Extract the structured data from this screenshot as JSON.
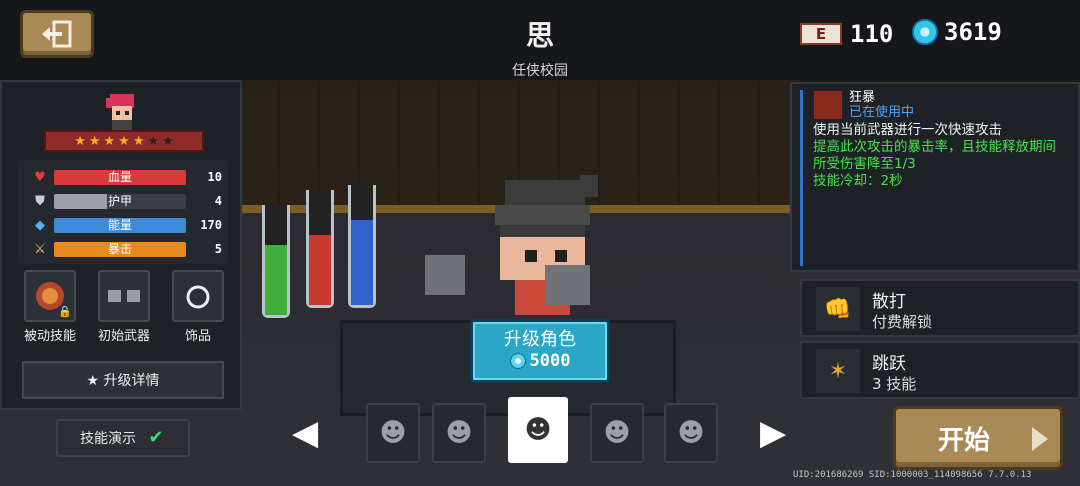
{
  "header": {
    "title": "思",
    "subtitle": "任侠校园",
    "energy_badge": "E",
    "energy_value": "110",
    "gems_value": "3619"
  },
  "character": {
    "stars_filled": 5,
    "stars_total": 7,
    "stats": [
      {
        "label": "血量",
        "value": "10",
        "icon": "heart-icon",
        "color": "#d83a3a",
        "fill": 1.0
      },
      {
        "label": "护甲",
        "value": "4",
        "icon": "shield-icon",
        "color": "#9aa0a6",
        "fill": 0.4
      },
      {
        "label": "能量",
        "value": "170",
        "icon": "diamond-icon",
        "color": "#3d8ad8",
        "fill": 1.0
      },
      {
        "label": "暴击",
        "value": "5",
        "icon": "sword-icon",
        "color": "#e98a1e",
        "fill": 1.0
      }
    ],
    "slots": [
      {
        "label": "被动技能",
        "locked": true
      },
      {
        "label": "初始武器",
        "locked": false
      },
      {
        "label": "饰品",
        "locked": false
      }
    ],
    "upgrade_detail": "★ 升级详情"
  },
  "demo": {
    "label": "技能演示",
    "checked": true
  },
  "upgrade_button": {
    "title": "升级角色",
    "cost": "5000"
  },
  "selected_skill": {
    "name": "狂暴",
    "status": "已在使用中",
    "desc_white": "使用当前武器进行一次快速攻击",
    "desc_green": "提高此次攻击的暴击率，且技能释放期间所受伤害降至1/3",
    "cooldown": "技能冷却：2秒"
  },
  "skills": [
    {
      "name": "散打",
      "sub": "付费解锁",
      "locked": true
    },
    {
      "name": "跳跃",
      "sub": "3 技能",
      "locked": false
    }
  ],
  "start_button": "开始",
  "uid_line": "UID:201686269 SID:1000003_114098656 7.7.0.13",
  "colors": {
    "accent_blue": "#2aa6c7",
    "button_brown": "#a98a57",
    "green_text": "#49e34a"
  }
}
